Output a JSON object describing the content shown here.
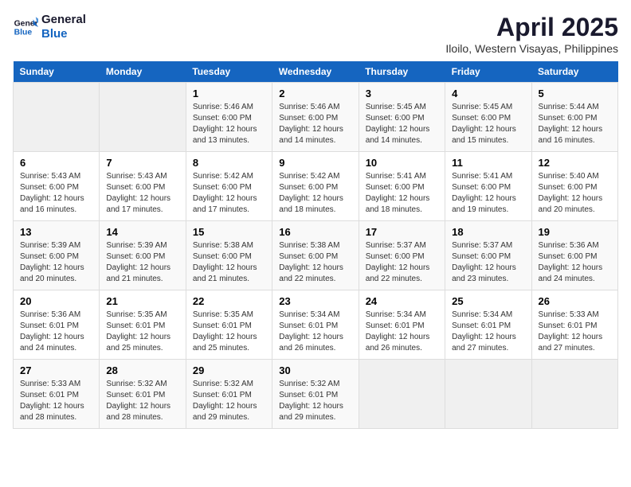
{
  "logo": {
    "line1": "General",
    "line2": "Blue"
  },
  "title": "April 2025",
  "subtitle": "Iloilo, Western Visayas, Philippines",
  "headers": [
    "Sunday",
    "Monday",
    "Tuesday",
    "Wednesday",
    "Thursday",
    "Friday",
    "Saturday"
  ],
  "weeks": [
    [
      {
        "empty": true
      },
      {
        "empty": true
      },
      {
        "day": "1",
        "sunrise": "5:46 AM",
        "sunset": "6:00 PM",
        "daylight": "12 hours and 13 minutes."
      },
      {
        "day": "2",
        "sunrise": "5:46 AM",
        "sunset": "6:00 PM",
        "daylight": "12 hours and 14 minutes."
      },
      {
        "day": "3",
        "sunrise": "5:45 AM",
        "sunset": "6:00 PM",
        "daylight": "12 hours and 14 minutes."
      },
      {
        "day": "4",
        "sunrise": "5:45 AM",
        "sunset": "6:00 PM",
        "daylight": "12 hours and 15 minutes."
      },
      {
        "day": "5",
        "sunrise": "5:44 AM",
        "sunset": "6:00 PM",
        "daylight": "12 hours and 16 minutes."
      }
    ],
    [
      {
        "day": "6",
        "sunrise": "5:43 AM",
        "sunset": "6:00 PM",
        "daylight": "12 hours and 16 minutes."
      },
      {
        "day": "7",
        "sunrise": "5:43 AM",
        "sunset": "6:00 PM",
        "daylight": "12 hours and 17 minutes."
      },
      {
        "day": "8",
        "sunrise": "5:42 AM",
        "sunset": "6:00 PM",
        "daylight": "12 hours and 17 minutes."
      },
      {
        "day": "9",
        "sunrise": "5:42 AM",
        "sunset": "6:00 PM",
        "daylight": "12 hours and 18 minutes."
      },
      {
        "day": "10",
        "sunrise": "5:41 AM",
        "sunset": "6:00 PM",
        "daylight": "12 hours and 18 minutes."
      },
      {
        "day": "11",
        "sunrise": "5:41 AM",
        "sunset": "6:00 PM",
        "daylight": "12 hours and 19 minutes."
      },
      {
        "day": "12",
        "sunrise": "5:40 AM",
        "sunset": "6:00 PM",
        "daylight": "12 hours and 20 minutes."
      }
    ],
    [
      {
        "day": "13",
        "sunrise": "5:39 AM",
        "sunset": "6:00 PM",
        "daylight": "12 hours and 20 minutes."
      },
      {
        "day": "14",
        "sunrise": "5:39 AM",
        "sunset": "6:00 PM",
        "daylight": "12 hours and 21 minutes."
      },
      {
        "day": "15",
        "sunrise": "5:38 AM",
        "sunset": "6:00 PM",
        "daylight": "12 hours and 21 minutes."
      },
      {
        "day": "16",
        "sunrise": "5:38 AM",
        "sunset": "6:00 PM",
        "daylight": "12 hours and 22 minutes."
      },
      {
        "day": "17",
        "sunrise": "5:37 AM",
        "sunset": "6:00 PM",
        "daylight": "12 hours and 22 minutes."
      },
      {
        "day": "18",
        "sunrise": "5:37 AM",
        "sunset": "6:00 PM",
        "daylight": "12 hours and 23 minutes."
      },
      {
        "day": "19",
        "sunrise": "5:36 AM",
        "sunset": "6:00 PM",
        "daylight": "12 hours and 24 minutes."
      }
    ],
    [
      {
        "day": "20",
        "sunrise": "5:36 AM",
        "sunset": "6:01 PM",
        "daylight": "12 hours and 24 minutes."
      },
      {
        "day": "21",
        "sunrise": "5:35 AM",
        "sunset": "6:01 PM",
        "daylight": "12 hours and 25 minutes."
      },
      {
        "day": "22",
        "sunrise": "5:35 AM",
        "sunset": "6:01 PM",
        "daylight": "12 hours and 25 minutes."
      },
      {
        "day": "23",
        "sunrise": "5:34 AM",
        "sunset": "6:01 PM",
        "daylight": "12 hours and 26 minutes."
      },
      {
        "day": "24",
        "sunrise": "5:34 AM",
        "sunset": "6:01 PM",
        "daylight": "12 hours and 26 minutes."
      },
      {
        "day": "25",
        "sunrise": "5:34 AM",
        "sunset": "6:01 PM",
        "daylight": "12 hours and 27 minutes."
      },
      {
        "day": "26",
        "sunrise": "5:33 AM",
        "sunset": "6:01 PM",
        "daylight": "12 hours and 27 minutes."
      }
    ],
    [
      {
        "day": "27",
        "sunrise": "5:33 AM",
        "sunset": "6:01 PM",
        "daylight": "12 hours and 28 minutes."
      },
      {
        "day": "28",
        "sunrise": "5:32 AM",
        "sunset": "6:01 PM",
        "daylight": "12 hours and 28 minutes."
      },
      {
        "day": "29",
        "sunrise": "5:32 AM",
        "sunset": "6:01 PM",
        "daylight": "12 hours and 29 minutes."
      },
      {
        "day": "30",
        "sunrise": "5:32 AM",
        "sunset": "6:01 PM",
        "daylight": "12 hours and 29 minutes."
      },
      {
        "empty": true
      },
      {
        "empty": true
      },
      {
        "empty": true
      }
    ]
  ],
  "labels": {
    "sunrise": "Sunrise:",
    "sunset": "Sunset:",
    "daylight": "Daylight:"
  }
}
